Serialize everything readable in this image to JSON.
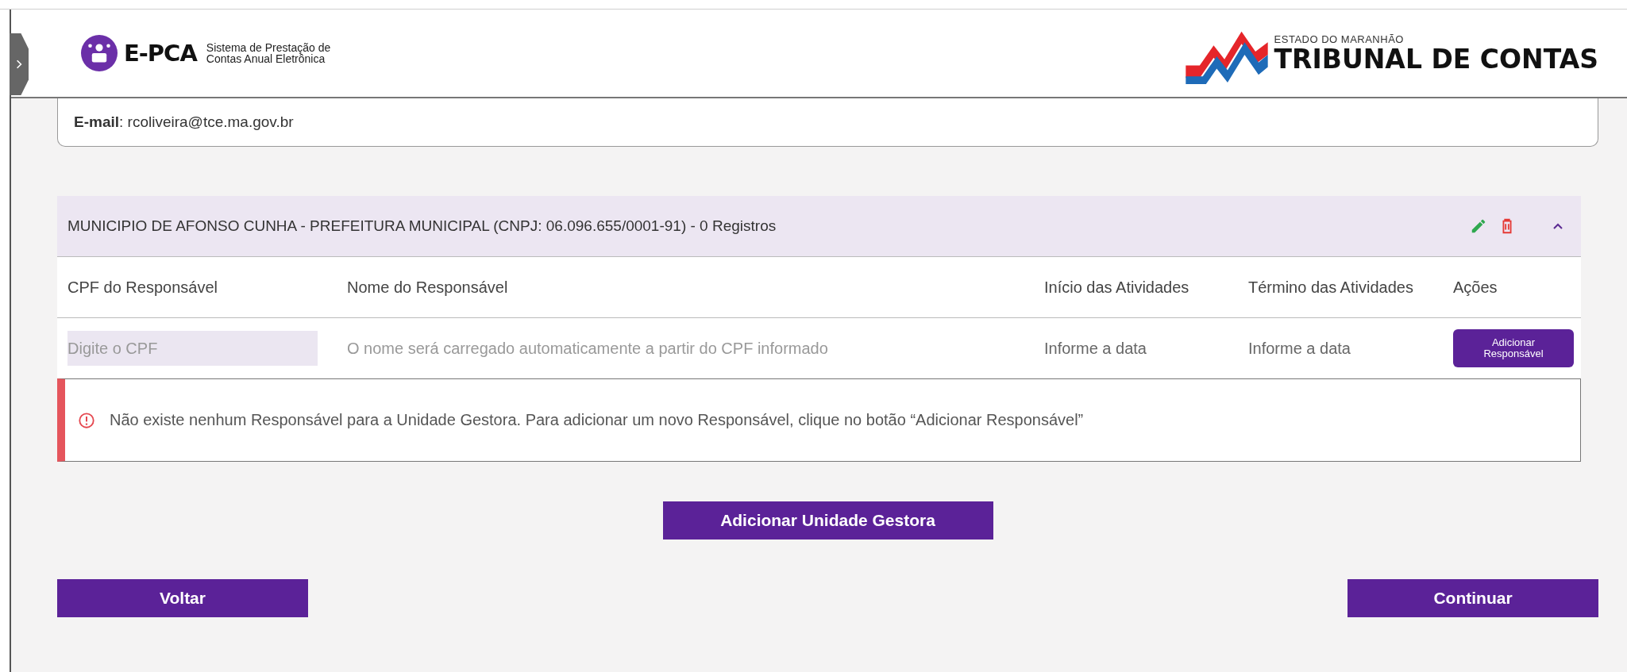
{
  "header": {
    "logo_name": "E-PCA",
    "logo_subtitle": [
      "Sistema de Prestação de",
      "Contas Anual Eletrônica"
    ],
    "org_top": "ESTADO DO MARANHÃO",
    "org_name": "TRIBUNAL DE CONTAS"
  },
  "contact": "**E-mail**: rcoliveira@tce.ma.gov.br",
  "unit": {
    "title": "MUNICIPIO DE AFONSO CUNHA - PREFEITURA MUNICIPAL (CNPJ: 06.096.655/0001-91) - 0 Registros",
    "expanded": true,
    "columns": [
      "CPF do Responsável",
      "Nome do Responsável",
      "Início das Atividades",
      "Término das Atividades",
      "Ações"
    ],
    "input_row": {
      "cpf_placeholder": "Digite o CPF",
      "name_placeholder": "O nome será carregado automaticamente a partir do CPF informado",
      "start_placeholder": "Informe a data",
      "end_placeholder": "Informe a data",
      "add_button": "Adicionar Responsável"
    },
    "alert": "Não existe nenhum Responsável para a Unidade Gestora. Para adicionar um novo Responsável, clique no botão “Adicionar Responsável”"
  },
  "add_unit_button": "Adicionar Unidade Gestora",
  "back_button": "Voltar",
  "continue_button": "Continuar"
}
